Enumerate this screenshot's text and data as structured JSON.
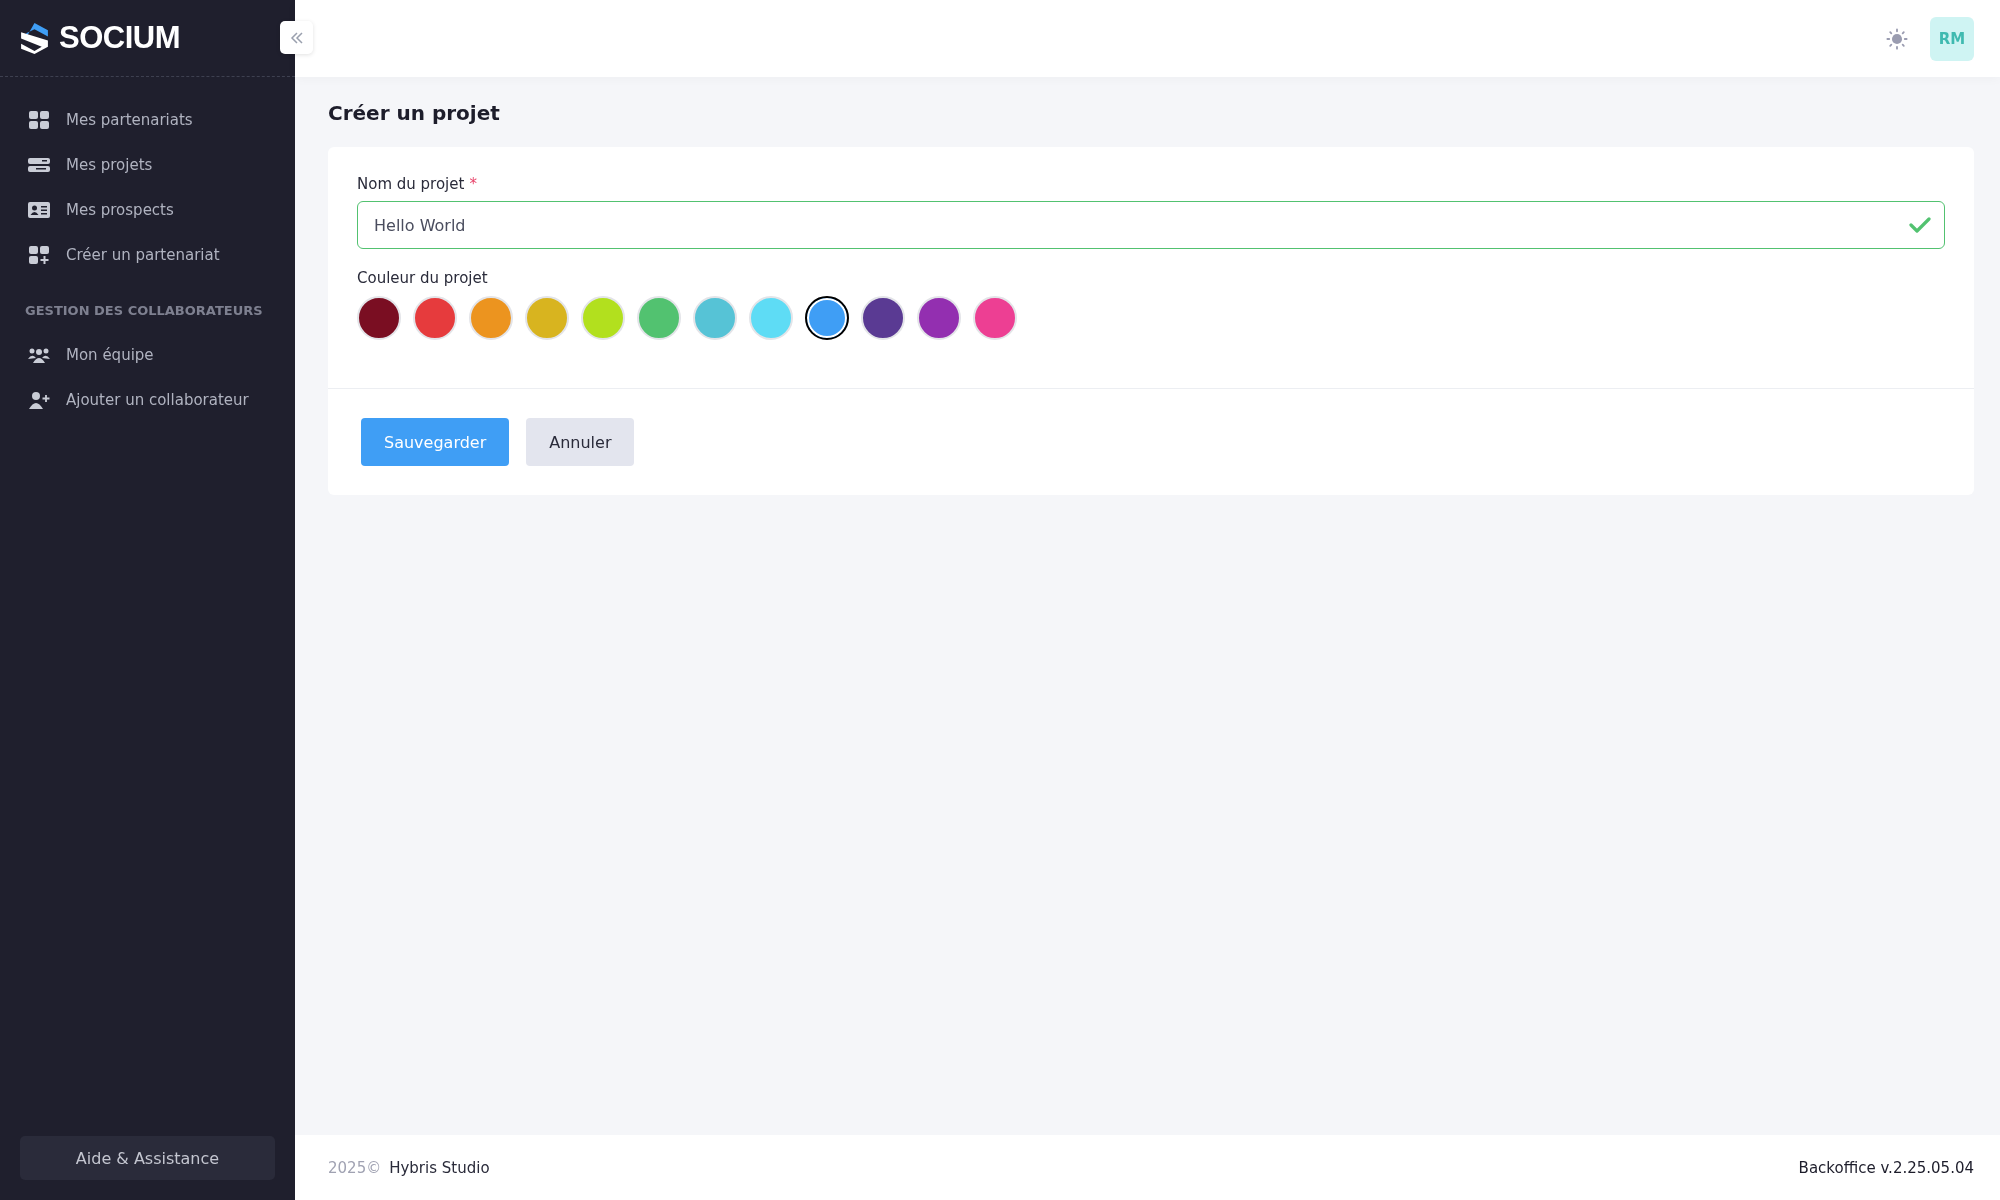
{
  "sidebar": {
    "logo": "SOCIUM",
    "sections": [
      {
        "items": [
          {
            "label": "Mes partenariats"
          },
          {
            "label": "Mes projets"
          },
          {
            "label": "Mes prospects"
          },
          {
            "label": "Créer un partenariat"
          }
        ]
      },
      {
        "title": "GESTION DES COLLABORATEURS",
        "items": [
          {
            "label": "Mon équipe"
          },
          {
            "label": "Ajouter un collaborateur"
          }
        ]
      }
    ],
    "help_button": "Aide & Assistance"
  },
  "header": {
    "avatar": "RM"
  },
  "page": {
    "title": "Créer un projet",
    "name_field": {
      "label": "Nom du projet",
      "required_mark": "*",
      "value": "Hello World",
      "valid": true
    },
    "color_label": "Couleur du projet",
    "colors": [
      {
        "color": "#7a0e22",
        "selected": false
      },
      {
        "color": "#e63b3d",
        "selected": false
      },
      {
        "color": "#ec941f",
        "selected": false
      },
      {
        "color": "#d8b41f",
        "selected": false
      },
      {
        "color": "#b2e01e",
        "selected": false
      },
      {
        "color": "#52c270",
        "selected": false
      },
      {
        "color": "#56c3d6",
        "selected": false
      },
      {
        "color": "#5edcf5",
        "selected": false
      },
      {
        "color": "#3f9ef5",
        "selected": true
      },
      {
        "color": "#5a3a93",
        "selected": false
      },
      {
        "color": "#932fb0",
        "selected": false
      },
      {
        "color": "#ed3f93",
        "selected": false
      }
    ],
    "buttons": [
      {
        "label": "Sauvegarder",
        "kind": "primary"
      },
      {
        "label": "Annuler",
        "kind": "secondary"
      }
    ]
  },
  "footer": {
    "year": "2025©",
    "company": "Hybris Studio",
    "version": "Backoffice v.2.25.05.04"
  }
}
